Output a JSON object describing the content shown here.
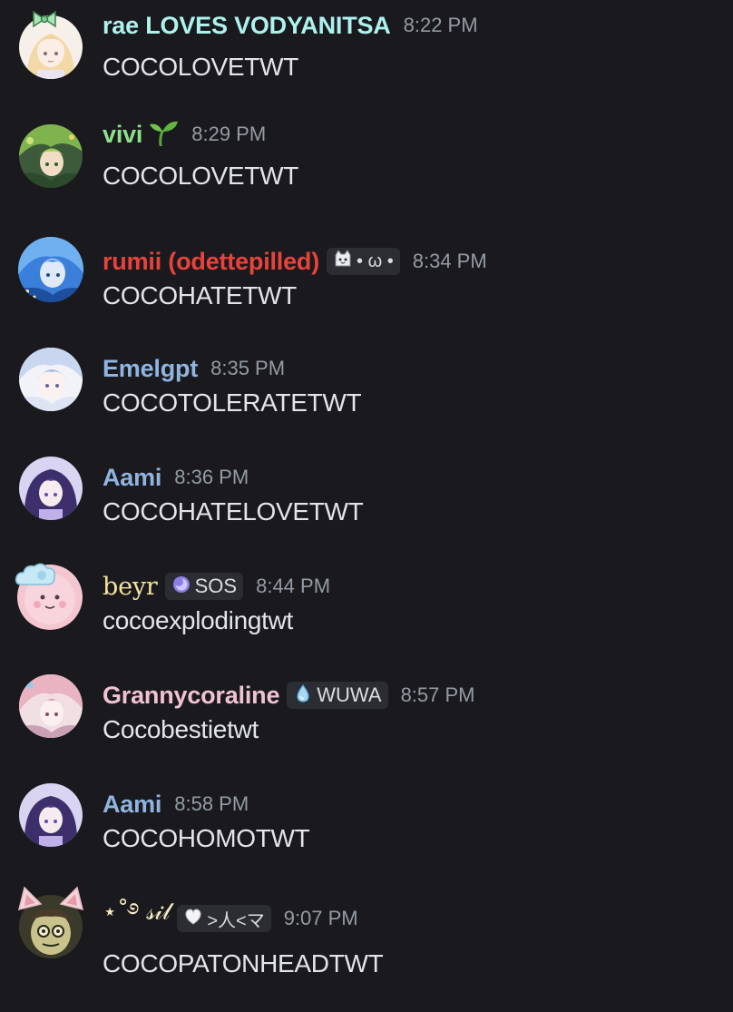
{
  "colors": {
    "background": "#1a1a1e",
    "message_text": "#e3e5e8",
    "timestamp": "#949ba4",
    "tag_bg": "#2b2d33"
  },
  "messages": [
    {
      "author": "rae LOVES VODYANITSA",
      "author_color": "#aef2ee",
      "time": "8:22 PM",
      "text": "COCOLOVETWT",
      "avatar_icon": "anime-girl-avatar"
    },
    {
      "author": "vivi",
      "author_color": "#8fe08a",
      "time": "8:29 PM",
      "text": "COCOLOVETWT",
      "avatar_icon": "green-hair-avatar",
      "badge_icon": "sprout-icon"
    },
    {
      "author": "rumii (odettepilled)",
      "author_color": "#e8433a",
      "time": "8:34 PM",
      "text": "COCOHATETWT",
      "avatar_icon": "blue-hair-avatar",
      "tag": {
        "icon": "cat-icon",
        "label": "• ω •"
      }
    },
    {
      "author": "Emelgpt",
      "author_color": "#8fb4e0",
      "time": "8:35 PM",
      "text": "COCOTOLERATETWT",
      "avatar_icon": "light-blue-hair-avatar"
    },
    {
      "author": "Aami",
      "author_color": "#8fb4e0",
      "time": "8:36 PM",
      "text": "COCOHATELOVETWT",
      "avatar_icon": "purple-hair-avatar"
    },
    {
      "author": "beyr",
      "author_color": "#f5e3a0",
      "time": "8:44 PM",
      "text": "cocoexplodingtwt",
      "avatar_icon": "pink-creature-avatar",
      "tag": {
        "icon": "moon-icon",
        "label": "SOS"
      }
    },
    {
      "author": "Grannycoraline",
      "author_color": "#f0c3d2",
      "time": "8:57 PM",
      "text": "Cocobestietwt",
      "avatar_icon": "pink-hair-avatar",
      "tag": {
        "icon": "water-drop-icon",
        "label": "WUWA"
      }
    },
    {
      "author": "Aami",
      "author_color": "#8fb4e0",
      "time": "8:58 PM",
      "text": "COCOHOMOTWT",
      "avatar_icon": "purple-hair-avatar"
    },
    {
      "author": "⋆˚࿔ 𝓈𝒾𝓁",
      "author_color": "#f7ecc5",
      "time": "9:07 PM",
      "text": "COCOPATONHEADTWT",
      "avatar_icon": "cat-ears-avatar",
      "tag": {
        "icon": "heart-icon",
        "label": ">人<マ"
      }
    }
  ]
}
